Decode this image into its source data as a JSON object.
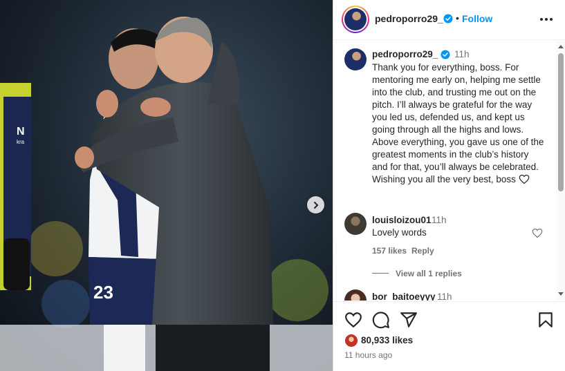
{
  "post": {
    "username": "pedroporro29_",
    "follow_label": "Follow",
    "dot": "•",
    "caption": {
      "username": "pedroporro29_",
      "time": "11h",
      "text": "Thank you for everything, boss. For mentoring me early on, helping me settle into the club, and trusting me out on the pitch. I’ll always be grateful for the way you led us, defended us, and kept us going through all the highs and lows. Above everything, you gave us one of the greatest moments in the club’s history and for that, you’ll always be celebrated. Wishing you all the very best, boss"
    },
    "comments": [
      {
        "username": "louisloizou01",
        "time": "11h",
        "text": "Lovely words",
        "likes": "157 likes",
        "reply_label": "Reply",
        "view_replies": "View all 1 replies"
      },
      {
        "username": "bor_baitoeyyy",
        "time": "11h"
      }
    ],
    "likes": {
      "count": "80,933",
      "word": "likes"
    },
    "posted_ago": "11 hours ago"
  },
  "photo": {
    "jersey_number": "23",
    "sleeve_text": "kra"
  },
  "icons": {
    "verified": "verified-badge-icon",
    "more": "more-options-icon",
    "like": "heart-icon",
    "comment": "comment-bubble-icon",
    "share": "paper-plane-icon",
    "save": "bookmark-icon",
    "next": "chevron-right-icon"
  },
  "colors": {
    "accent_blue": "#0095f6",
    "text": "#262626",
    "secondary_text": "#737373"
  }
}
